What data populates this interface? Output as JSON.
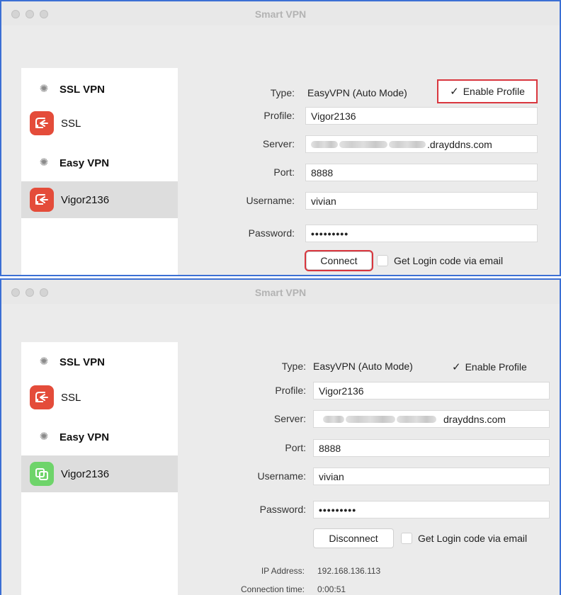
{
  "window_title": "Smart VPN",
  "top": {
    "sidebar": {
      "groups": [
        {
          "header": "SSL VPN",
          "item": "SSL",
          "item_color": "#e44c3a"
        },
        {
          "header": "Easy VPN",
          "item": "Vigor2136",
          "item_color": "#e44c3a"
        }
      ]
    },
    "form": {
      "type_label": "Type:",
      "type_value": "EasyVPN (Auto Mode)",
      "enable_profile": "Enable Profile",
      "profile_label": "Profile:",
      "profile_value": "Vigor2136",
      "server_label": "Server:",
      "server_value": ".drayddns.com",
      "port_label": "Port:",
      "port_value": "8888",
      "username_label": "Username:",
      "username_value": "vivian",
      "password_label": "Password:",
      "password_value": "•••••••••",
      "connect_button": "Connect",
      "login_code": "Get Login code via email"
    }
  },
  "bottom": {
    "sidebar": {
      "groups": [
        {
          "header": "SSL VPN",
          "item": "SSL",
          "item_color": "#e44c3a"
        },
        {
          "header": "Easy VPN",
          "item": "Vigor2136",
          "item_color": "#6ed46a"
        }
      ]
    },
    "form": {
      "type_label": "Type:",
      "type_value": "EasyVPN (Auto Mode)",
      "enable_profile": "Enable Profile",
      "profile_label": "Profile:",
      "profile_value": "Vigor2136",
      "server_label": "Server:",
      "server_value": "drayddns.com",
      "port_label": "Port:",
      "port_value": "8888",
      "username_label": "Username:",
      "username_value": "vivian",
      "password_label": "Password:",
      "password_value": "•••••••••",
      "disconnect_button": "Disconnect",
      "login_code": "Get Login code via email",
      "ip_label": "IP Address:",
      "ip_value": "192.168.136.113",
      "conn_time_label": "Connection time:",
      "conn_time_value": "0:00:51"
    }
  },
  "colors": {
    "highlight": "#d9363e",
    "frame": "#3b6fd4"
  }
}
